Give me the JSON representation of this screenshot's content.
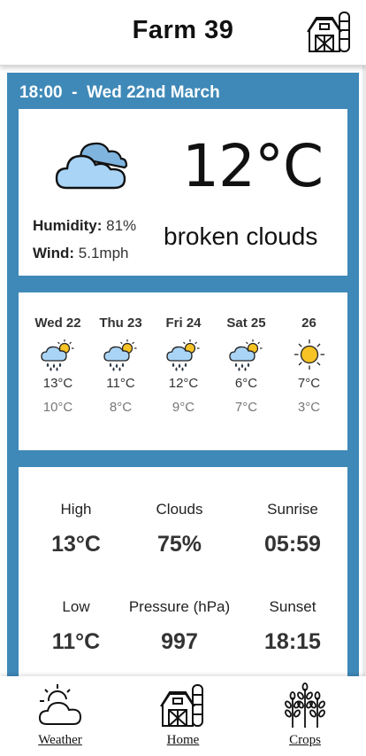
{
  "header": {
    "title": "Farm 39",
    "icon": "barn-icon"
  },
  "current": {
    "time": "18:00",
    "separator": "-",
    "date": "Wed 22nd March",
    "temperature": "12°C",
    "humidity_label": "Humidity:",
    "humidity_value": "81%",
    "wind_label": "Wind:",
    "wind_value": "5.1mph",
    "description": "broken clouds",
    "icon": "cloud-icon"
  },
  "forecast": [
    {
      "day": "Wed 22",
      "high": "13°C",
      "low": "10°C",
      "icon": "rain-sun-icon"
    },
    {
      "day": "Thu 23",
      "high": "11°C",
      "low": "8°C",
      "icon": "rain-sun-icon"
    },
    {
      "day": "Fri 24",
      "high": "12°C",
      "low": "9°C",
      "icon": "rain-sun-icon"
    },
    {
      "day": "Sat 25",
      "high": "6°C",
      "low": "7°C",
      "icon": "rain-sun-icon"
    },
    {
      "day": "26",
      "high": "7°C",
      "low": "3°C",
      "icon": "sun-icon"
    }
  ],
  "stats": {
    "high_label": "High",
    "high_value": "13°C",
    "clouds_label": "Clouds",
    "clouds_value": "75%",
    "sunrise_label": "Sunrise",
    "sunrise_value": "05:59",
    "low_label": "Low",
    "low_value": "11°C",
    "pressure_label": "Pressure (hPa)",
    "pressure_value": "997",
    "sunset_label": "Sunset",
    "sunset_value": "18:15"
  },
  "nav": {
    "weather": "Weather",
    "home": "Home",
    "crops": "Crops"
  },
  "colors": {
    "panel_blue": "#3f89b8",
    "cloud_fill": "#a9d4f5",
    "sun": "#f7c325",
    "rain": "#2f7fd1"
  }
}
